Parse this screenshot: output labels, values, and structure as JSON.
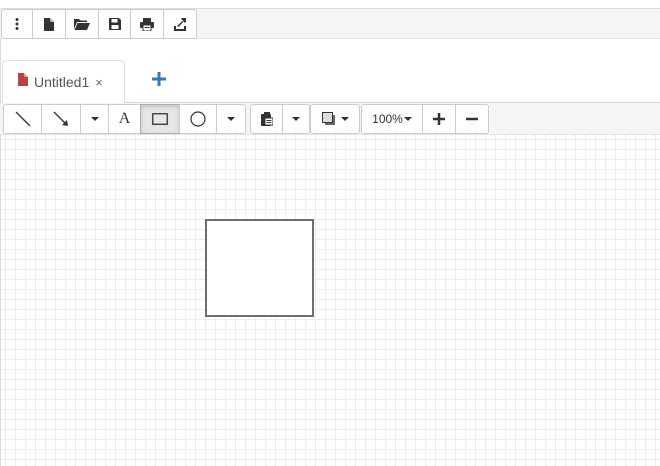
{
  "file_toolbar": {
    "buttons": [
      {
        "icon": "kebab-menu-icon"
      },
      {
        "icon": "new-file-icon"
      },
      {
        "icon": "open-folder-icon"
      },
      {
        "icon": "save-icon"
      },
      {
        "icon": "print-icon"
      },
      {
        "icon": "export-icon"
      }
    ]
  },
  "tabs": [
    {
      "label": "Untitled1",
      "close_label": "×",
      "icon": "document-icon",
      "icon_color": "#b54444"
    }
  ],
  "add_tab_icon": "plus-icon",
  "add_tab_color": "#337ab7",
  "draw_toolbar": {
    "tools": [
      {
        "icon": "line-tool-icon"
      },
      {
        "icon": "arrow-tool-icon"
      },
      {
        "icon": "chevron-down-icon"
      },
      {
        "icon": "text-tool-icon",
        "glyph": "A"
      },
      {
        "icon": "rectangle-tool-icon",
        "active": true
      },
      {
        "icon": "ellipse-tool-icon"
      },
      {
        "icon": "chevron-down-icon"
      },
      {
        "icon": "paste-stamp-icon"
      },
      {
        "icon": "chevron-down-icon"
      },
      {
        "icon": "fill-color-icon"
      }
    ],
    "zoom_label": "100%",
    "zoom_in_icon": "zoom-in-plus-icon",
    "zoom_out_icon": "zoom-out-minus-icon"
  },
  "canvas": {
    "grid": true,
    "shapes": [
      {
        "type": "rectangle",
        "stroke": "#6e6e6e",
        "fill": "#ffffff"
      }
    ]
  }
}
